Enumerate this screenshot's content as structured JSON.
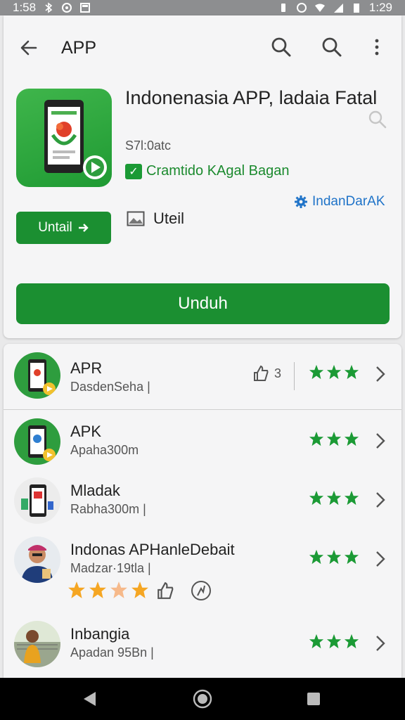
{
  "status": {
    "time_left": "1:58",
    "time_right": "1:29"
  },
  "appbar": {
    "title": "APP"
  },
  "app": {
    "title": "Indonenasia APP, ladaia Fatal",
    "subtitle": "S7l:0atc",
    "developer": "Cramtido KAgal Bagan",
    "partner": "IndanDarAK",
    "install_label": "Untail",
    "screenshots_label": "Uteil",
    "download_label": "Unduh"
  },
  "list": [
    {
      "title": "APR",
      "subtitle": "DasdenSeha",
      "likes": "3",
      "stars": 3
    },
    {
      "title": "APK",
      "subtitle": "Apaha300m",
      "stars": 3
    },
    {
      "title": "Mladak",
      "subtitle": "Rabha300m",
      "stars": 3
    },
    {
      "title": "Indonas APHanleDebait",
      "subtitle": "Madzar·19tla",
      "stars": 3,
      "rating_stars": 4
    },
    {
      "title": "Inbangia",
      "subtitle": "Apadan 95Bn",
      "stars": 3
    }
  ],
  "colors": {
    "accent": "#1b8f31",
    "link": "#1f73c8",
    "star_green": "#1b9a35",
    "star_orange": "#f5a623"
  }
}
